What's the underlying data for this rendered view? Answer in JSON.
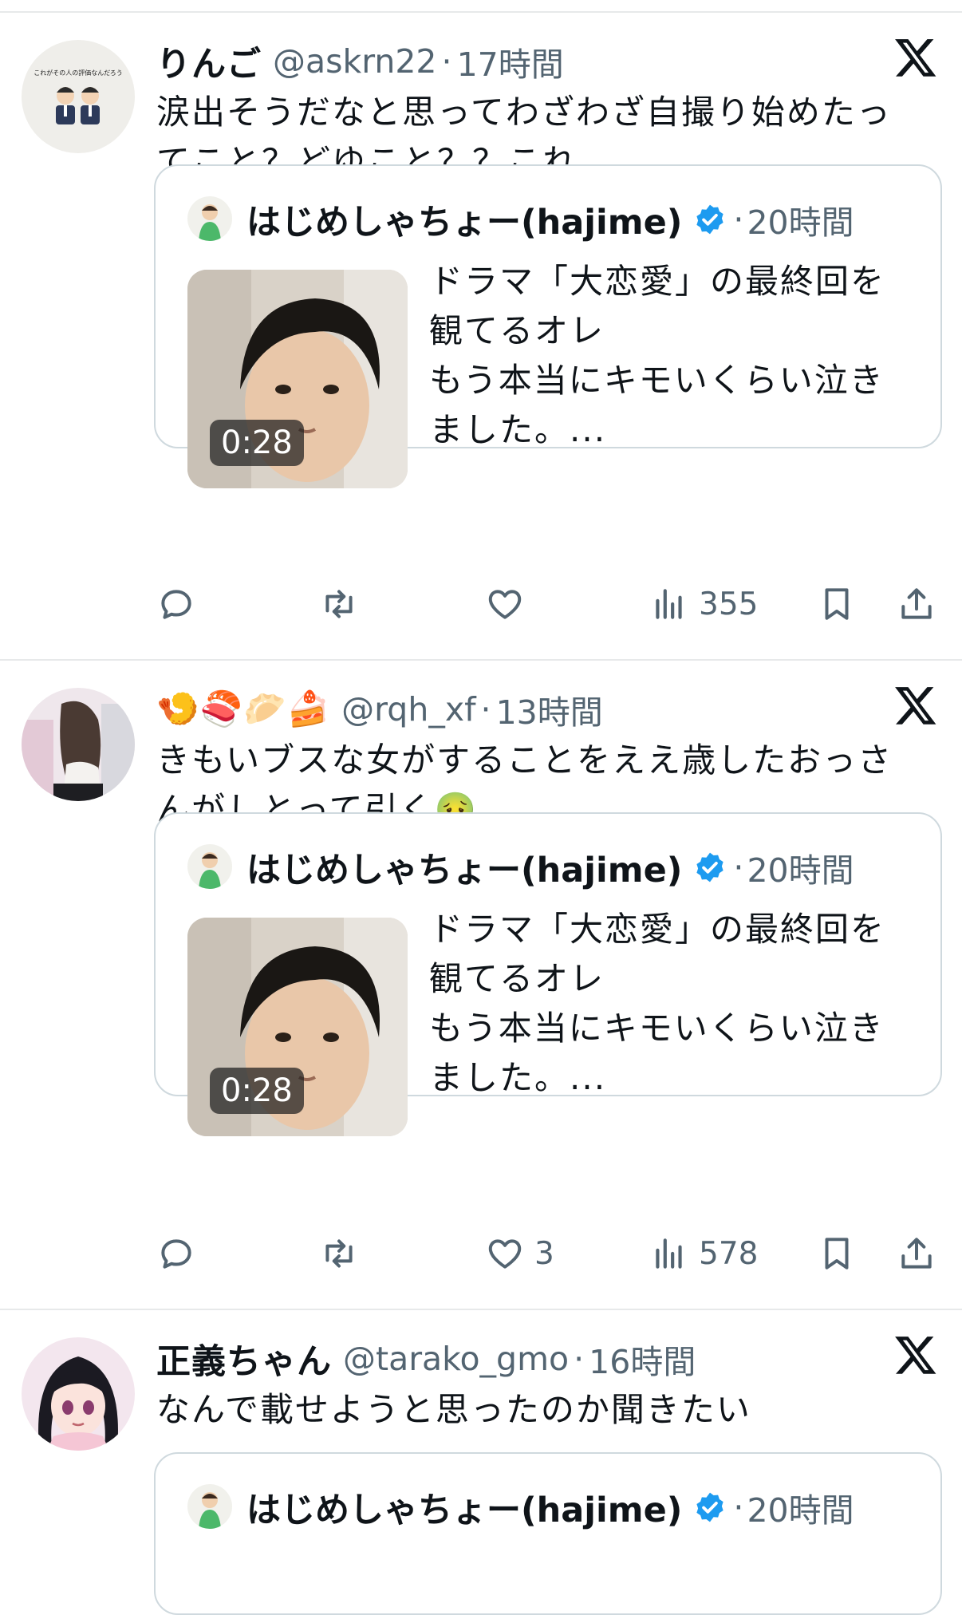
{
  "tweets": [
    {
      "name": "りんご",
      "handle": "@askrn22",
      "dot": "·",
      "time": "17時間",
      "text_lines": [
        "涙出そうだなと思ってわざわざ自撮り始めたっ",
        "てこと？どゆこと？？これ"
      ],
      "avatar_icon": "couple-illustration-avatar",
      "avatar_caption": "これがその人の評価なんだろう",
      "quote": {
        "name": "はじめしゃちょー(hajime)",
        "dot": "·",
        "time": "20時間",
        "duration": "0:28",
        "text_lines": [
          "ドラマ「大恋愛」の最終回を",
          "観てるオレ",
          "もう本当にキモいくらい泣き",
          "ました。..."
        ]
      },
      "actions": {
        "reply": "",
        "retweet": "",
        "like": "",
        "views": "355"
      }
    },
    {
      "name": "🍤🍣🥟🍰",
      "handle": "@rqh_xf",
      "dot": "·",
      "time": "13時間",
      "text_lines": [
        "きもいブスな女がすることをええ歳したおっさ",
        "んがしとって引く🤢"
      ],
      "avatar_icon": "girl-photo-avatar",
      "quote": {
        "name": "はじめしゃちょー(hajime)",
        "dot": "·",
        "time": "20時間",
        "duration": "0:28",
        "text_lines": [
          "ドラマ「大恋愛」の最終回を",
          "観てるオレ",
          "もう本当にキモいくらい泣き",
          "ました。..."
        ]
      },
      "actions": {
        "reply": "",
        "retweet": "",
        "like": "3",
        "views": "578"
      }
    },
    {
      "name": "正義ちゃん",
      "handle": "@tarako_gmo",
      "dot": "·",
      "time": "16時間",
      "text_lines": [
        "なんで載せようと思ったのか聞きたい"
      ],
      "avatar_icon": "anime-girl-avatar",
      "quote": {
        "name": "はじめしゃちょー(hajime)",
        "dot": "·",
        "time": "20時間"
      }
    }
  ],
  "colors": {
    "text": "#0f1419",
    "secondary": "#536471",
    "border": "#cfd9de",
    "verified": "#1d9bf0"
  }
}
